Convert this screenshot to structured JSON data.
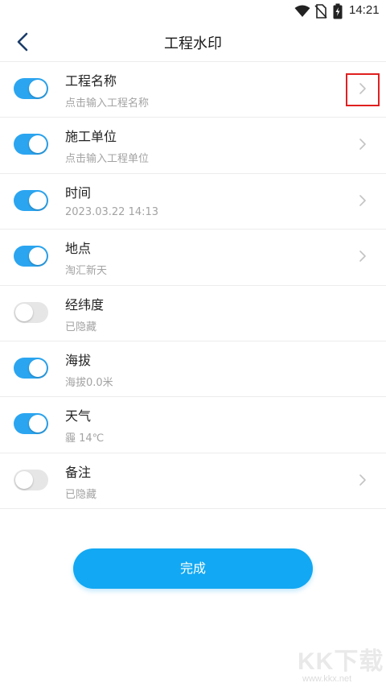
{
  "status_bar": {
    "time": "14:21"
  },
  "header": {
    "title": "工程水印"
  },
  "items": [
    {
      "title": "工程名称",
      "subtitle": "点击输入工程名称",
      "enabled": true,
      "has_arrow": true
    },
    {
      "title": "施工单位",
      "subtitle": "点击输入工程单位",
      "enabled": true,
      "has_arrow": true
    },
    {
      "title": "时间",
      "subtitle": "2023.03.22 14:13",
      "enabled": true,
      "has_arrow": true
    },
    {
      "title": "地点",
      "subtitle": "淘汇新天",
      "enabled": true,
      "has_arrow": true
    },
    {
      "title": "经纬度",
      "subtitle": "已隐藏",
      "enabled": false,
      "has_arrow": false
    },
    {
      "title": "海拔",
      "subtitle": "海拔0.0米",
      "enabled": true,
      "has_arrow": false
    },
    {
      "title": "天气",
      "subtitle": "霾 14℃",
      "enabled": true,
      "has_arrow": false
    },
    {
      "title": "备注",
      "subtitle": "已隐藏",
      "enabled": false,
      "has_arrow": true
    }
  ],
  "footer": {
    "done_label": "完成"
  },
  "watermark": {
    "logo": "KK下载",
    "url": "www.kkx.net"
  },
  "colors": {
    "accent": "#12a8f3",
    "toggle_on": "#2ba5f0",
    "toggle_off": "#e6e6e6",
    "highlight": "#e02020"
  }
}
